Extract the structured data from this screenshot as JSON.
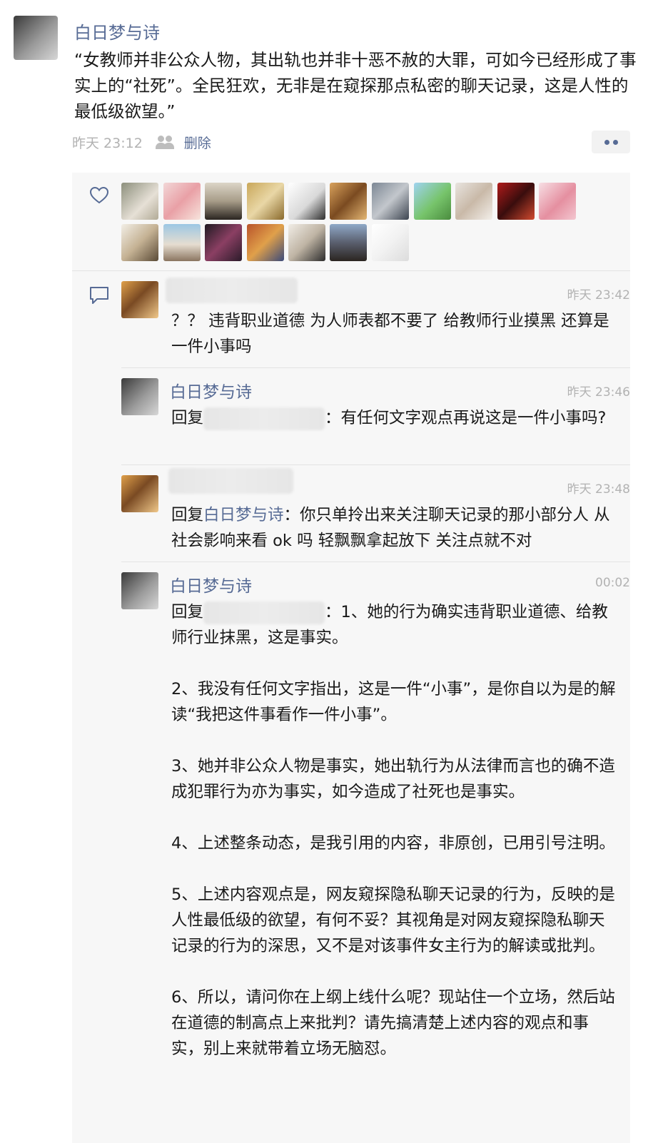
{
  "post": {
    "author": "白日梦与诗",
    "text": "“女教师并非公众人物，其出轨也并非十恶不赦的大罪，可如今已经形成了事实上的“社死”。全民狂欢，无非是在窥探那点私密的聊天记录，这是人性的最低级欲望。”",
    "time": "昨天 23:12",
    "delete_label": "删除"
  },
  "comments": [
    {
      "time": "昨天 23:42",
      "text": "？？ 违背职业道德 为人师表都不要了 给教师行业摸黑 还算是一件小事吗"
    },
    {
      "name": "白日梦与诗",
      "time": "昨天 23:46",
      "reply_prefix": "回复",
      "text_after": "：有任何文字观点再说这是一件小事吗?"
    },
    {
      "time": "昨天 23:48",
      "reply_prefix": "回复",
      "reply_to": "白日梦与诗",
      "text_after": "：你只单拎出来关注聊天记录的那小部分人 从社会影响来看 ok 吗 轻飘飘拿起放下 关注点就不对"
    },
    {
      "name": "白日梦与诗",
      "time": "00:02",
      "reply_prefix": "回复",
      "text_after": "：1、她的行为确实违背职业道德、给教师行业抹黑，这是事实。\n\n2、我没有任何文字指出，这是一件“小事”，是你自以为是的解读“我把这件事看作一件小事”。\n\n3、她并非公众人物是事实，她出轨行为从法律而言也的确不造成犯罪行为亦为事实，如今造成了社死也是事实。\n\n4、上述整条动态，是我引用的内容，非原创，已用引号注明。\n\n5、上述内容观点是，网友窥探隐私聊天记录的行为，反映的是人性最低级的欲望，有何不妥？其视角是对网友窥探隐私聊天记录的行为的深思，又不是对该事件女主行为的解读或批判。\n\n6、所以，请问你在上纲上线什么呢？现站住一个立场，然后站在道德的制高点上来批判？请先搞清楚上述内容的观点和事实，别上来就带着立场无脑怼。"
    }
  ]
}
